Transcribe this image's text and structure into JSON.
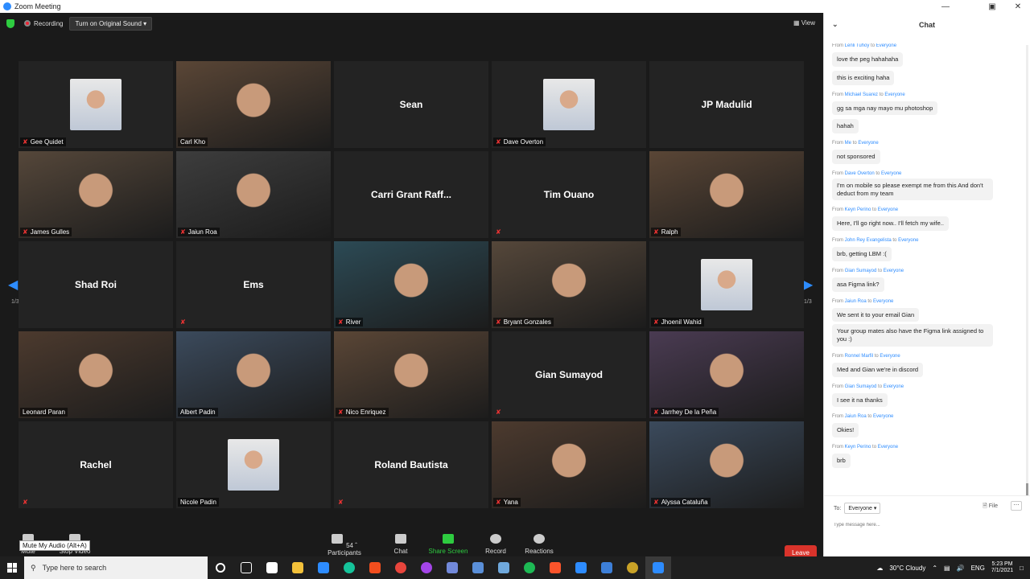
{
  "window": {
    "title": "Zoom Meeting"
  },
  "meeting_topbar": {
    "recording_label": "Recording",
    "original_sound_label": "Turn on Original Sound",
    "view_label": "View"
  },
  "pager": {
    "left_page": "1/3",
    "right_page": "1/3"
  },
  "participants": [
    {
      "name": "Gee Quidet",
      "type": "avatar",
      "muted": true,
      "big_name": ""
    },
    {
      "name": "Carl Kho",
      "type": "video",
      "muted": false,
      "big_name": ""
    },
    {
      "name": "",
      "type": "name",
      "muted": false,
      "big_name": "Sean"
    },
    {
      "name": "Dave Overton",
      "type": "avatar",
      "muted": true,
      "big_name": ""
    },
    {
      "name": "",
      "type": "name",
      "muted": false,
      "big_name": "JP Madulid"
    },
    {
      "name": "James Gulles",
      "type": "video",
      "muted": true,
      "big_name": ""
    },
    {
      "name": "Jaiun Roa",
      "type": "video",
      "muted": true,
      "big_name": ""
    },
    {
      "name": "",
      "type": "name",
      "muted": false,
      "big_name": "Carri Grant Raff..."
    },
    {
      "name": "",
      "type": "name",
      "muted": true,
      "big_name": "Tim Ouano"
    },
    {
      "name": "Ralph",
      "type": "video",
      "muted": true,
      "big_name": ""
    },
    {
      "name": "",
      "type": "name",
      "muted": false,
      "big_name": "Shad Roi"
    },
    {
      "name": "",
      "type": "name",
      "muted": true,
      "big_name": "Ems"
    },
    {
      "name": "River",
      "type": "video",
      "muted": true,
      "big_name": ""
    },
    {
      "name": "Bryant Gonzales",
      "type": "video",
      "muted": true,
      "big_name": ""
    },
    {
      "name": "Jhoenil Wahid",
      "type": "avatar",
      "muted": true,
      "big_name": ""
    },
    {
      "name": "Leonard Paran",
      "type": "video",
      "muted": false,
      "big_name": ""
    },
    {
      "name": "Albert Padin",
      "type": "video",
      "muted": false,
      "big_name": ""
    },
    {
      "name": "Nico Enriquez",
      "type": "video",
      "muted": true,
      "big_name": ""
    },
    {
      "name": "",
      "type": "name",
      "muted": true,
      "big_name": "Gian Sumayod"
    },
    {
      "name": "Jarrhey De la Peña",
      "type": "video",
      "muted": true,
      "big_name": ""
    },
    {
      "name": "",
      "type": "name",
      "muted": true,
      "big_name": "Rachel"
    },
    {
      "name": "Nicole Padin",
      "type": "avatar",
      "muted": false,
      "big_name": ""
    },
    {
      "name": "",
      "type": "name",
      "muted": true,
      "big_name": "Roland Bautista"
    },
    {
      "name": "Yana",
      "type": "video",
      "muted": true,
      "big_name": ""
    },
    {
      "name": "Alyssa Cataluña",
      "type": "video",
      "muted": true,
      "big_name": ""
    }
  ],
  "active_speaker_index": 15,
  "toolbar": {
    "mute_label": "Mute",
    "stop_video_label": "Stop Video",
    "participants_label": "Participants",
    "participants_count": "54",
    "chat_label": "Chat",
    "share_label": "Share Screen",
    "record_label": "Record",
    "reactions_label": "Reactions",
    "leave_label": "Leave",
    "tooltip": "Mute My Audio (Alt+A)"
  },
  "chat": {
    "title": "Chat",
    "to_label": "To:",
    "recipient": "Everyone",
    "file_label": "File",
    "input_placeholder": "Type message here...",
    "messages": [
      {
        "from": "Lenli Tuhoy",
        "to": "Everyone",
        "texts": [
          "love the peg hahahaha",
          "this is exciting haha"
        ]
      },
      {
        "from": "Michael Suarez",
        "to": "Everyone",
        "texts": [
          "gg sa mga nay mayo mu photoshop",
          "hahah"
        ]
      },
      {
        "from": "Me",
        "to": "Everyone",
        "texts": [
          "not sponsored"
        ]
      },
      {
        "from": "Dave Overton",
        "to": "Everyone",
        "texts": [
          "I'm on mobile so please exempt me from this And don't deduct from my team"
        ]
      },
      {
        "from": "Keyn Perino",
        "to": "Everyone",
        "texts": [
          "Here, I'll go right now.. I'll fetch my wife.."
        ]
      },
      {
        "from": "John Rey Evangelista",
        "to": "Everyone",
        "texts": [
          "brb, getting LBM :("
        ]
      },
      {
        "from": "Gian Sumayod",
        "to": "Everyone",
        "texts": [
          "asa Figma link?"
        ]
      },
      {
        "from": "Jaiun Roa",
        "to": "Everyone",
        "texts": [
          "We sent it to your email Gian",
          "Your group mates also have the Figma link assigned to you :)"
        ]
      },
      {
        "from": "Ronnel Marfil",
        "to": "Everyone",
        "texts": [
          "Med and Gian we're in discord"
        ]
      },
      {
        "from": "Gian Sumayod",
        "to": "Everyone",
        "texts": [
          "I see it na thanks"
        ]
      },
      {
        "from": "Jaiun Roa",
        "to": "Everyone",
        "texts": [
          "Okies!"
        ]
      },
      {
        "from": "Keyn Perino",
        "to": "Everyone",
        "texts": [
          "brb"
        ]
      }
    ]
  },
  "taskbar": {
    "search_placeholder": "Type here to search",
    "weather": "30°C  Cloudy",
    "language": "ENG",
    "time": "5:23 PM",
    "date": "7/1/2021"
  },
  "colors": {
    "accent": "#2d8cff",
    "leave": "#d9332b",
    "share": "#2ecc40",
    "active_outline": "#f1e27b"
  }
}
